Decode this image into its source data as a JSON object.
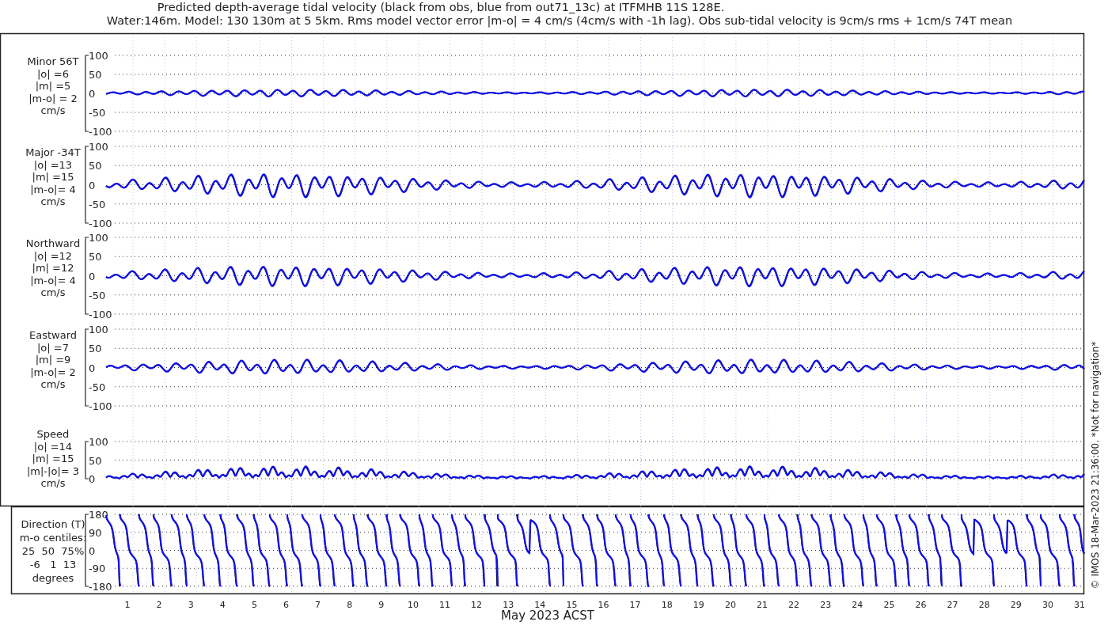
{
  "title_lines": [
    "Predicted depth-average tidal velocity (black from obs, blue from out71_13c) at ITFMHB 11S 128E.",
    "Water:146m. Model: 130 130m at 5 5km. Rms model vector error |m-o| = 4 cm/s (4cm/s with -1h lag). Obs sub-tidal velocity is 9cm/s rms + 1cm/s 74T mean"
  ],
  "panels": [
    {
      "kind": "minor",
      "label_lines": [
        "Minor 56T",
        "|o| =6",
        "|m| =5",
        "|m-o| = 2",
        "cm/s"
      ],
      "yticks": [
        "100",
        "50",
        "0",
        "-50",
        "-100"
      ]
    },
    {
      "kind": "major",
      "label_lines": [
        "Major -34T",
        "|o| =13",
        "|m| =15",
        "|m-o|= 4",
        "cm/s"
      ],
      "yticks": [
        "100",
        "50",
        "0",
        "-50",
        "-100"
      ]
    },
    {
      "kind": "northward",
      "label_lines": [
        "Northward",
        "|o| =12",
        "|m| =12",
        "|m-o|= 4",
        "cm/s"
      ],
      "yticks": [
        "100",
        "50",
        "0",
        "-50",
        "-100"
      ]
    },
    {
      "kind": "eastward",
      "label_lines": [
        "Eastward",
        "|o| =7",
        "|m| =9",
        "|m-o|= 2",
        "cm/s"
      ],
      "yticks": [
        "100",
        "50",
        "0",
        "-50",
        "-100"
      ]
    },
    {
      "kind": "speed",
      "label_lines": [
        "Speed",
        "|o| =14",
        "|m| =15",
        "|m|-|o|= 3",
        "cm/s"
      ],
      "yticks": [
        "100",
        "50",
        "0"
      ]
    },
    {
      "kind": "direction",
      "label_lines": [
        "Direction (T)",
        "m-o centiles:",
        "25  50  75%",
        "-6   1  13",
        "degrees"
      ],
      "yticks": [
        "180",
        "90",
        "0",
        "-90",
        "-180"
      ]
    }
  ],
  "x_tick_labels": [
    "1",
    "2",
    "3",
    "4",
    "5",
    "6",
    "7",
    "8",
    "9",
    "10",
    "11",
    "12",
    "13",
    "14",
    "15",
    "16",
    "17",
    "18",
    "19",
    "20",
    "21",
    "22",
    "23",
    "24",
    "25",
    "26",
    "27",
    "28",
    "29",
    "30",
    "31"
  ],
  "xlabel": "May 2023 ACST",
  "credit": "© IMOS 18-Mar-2023 21:36:00. *Not for navigation*"
}
